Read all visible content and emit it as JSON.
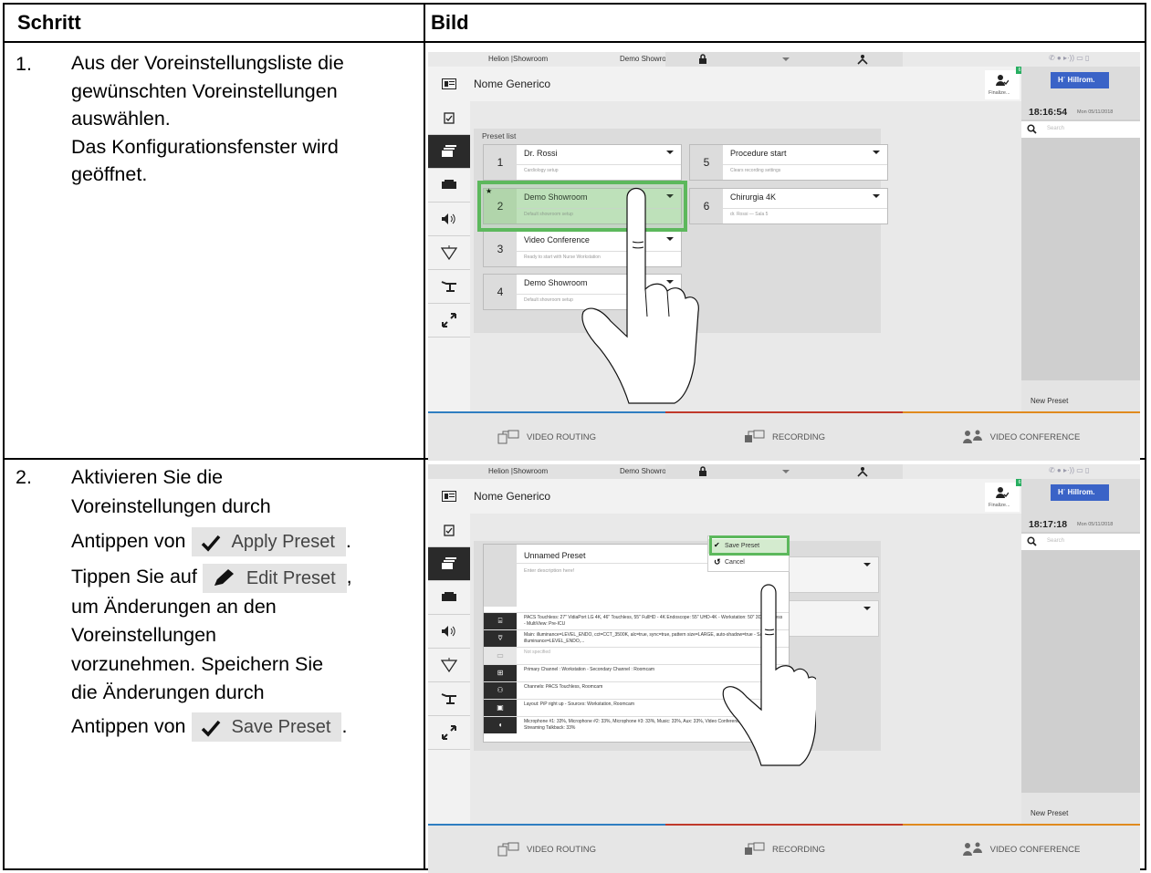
{
  "header": {
    "col_step": "Schritt",
    "col_image": "Bild"
  },
  "rows": [
    {
      "num": "1.",
      "lines": [
        "Aus der Voreinstellungsliste die",
        "gewünschten Voreinstellungen",
        "auswählen.",
        "Das Konfigurationsfenster wird",
        "geöffnet."
      ]
    },
    {
      "num": "2.",
      "line1": "Aktivieren Sie die",
      "line2": "Voreinstellungen durch",
      "line3_pre": "Antippen von",
      "apply_chip": "Apply Preset",
      "line3_post": ".",
      "line4_pre": "Tippen Sie auf",
      "edit_chip": "Edit Preset",
      "line4_post": ",",
      "line5": "um Änderungen an den",
      "line6": "Voreinstellungen",
      "line7": "vorzunehmen. Speichern Sie",
      "line8": "die Änderungen durch",
      "line9_pre": "Antippen von",
      "save_chip": "Save Preset",
      "line9_post": "."
    }
  ],
  "screen1": {
    "topbar": {
      "left": "Helion |Showroom",
      "mid": "Demo Showroom"
    },
    "user": "Nome Generico",
    "finalize": "Finalize...",
    "brand": "Hillrom.",
    "brand_mark": "H",
    "clock": "18:16:54",
    "date": "Mon 05/11/2018",
    "search_placeholder": "Search",
    "new_preset": "New Preset",
    "preset_list_label": "Preset list",
    "presets": [
      {
        "num": "1",
        "name": "Dr. Rossi",
        "desc": "Cardiology setup"
      },
      {
        "num": "2",
        "name": "Demo Showroom",
        "desc": "Default showroom setup",
        "star": "★"
      },
      {
        "num": "3",
        "name": "Video Conference",
        "desc": "Ready to start with Nurse Workstation"
      },
      {
        "num": "4",
        "name": "Demo Showroom",
        "desc": "Default showroom setup"
      },
      {
        "num": "5",
        "name": "Procedure start",
        "desc": "Clears recording settings"
      },
      {
        "num": "6",
        "name": "Chirurgia 4K",
        "desc": "dr. Rossi — Sala 5"
      }
    ],
    "tabs": [
      "VIDEO ROUTING",
      "RECORDING",
      "VIDEO CONFERENCE"
    ],
    "notif_badge": "6"
  },
  "screen2": {
    "topbar": {
      "left": "Helion |Showroom",
      "mid": "Demo Showroom"
    },
    "user": "Nome Generico",
    "finalize": "Finalize...",
    "brand": "Hillrom.",
    "brand_mark": "H",
    "clock": "18:17:18",
    "date": "Mon 05/11/2018",
    "search_placeholder": "Search",
    "new_preset": "New Preset",
    "dialog_title": "Unnamed Preset",
    "dialog_desc": "Enter description here!",
    "save_preset": "Save Preset",
    "cancel": "Cancel",
    "details": [
      "PACS Touchless: 27\" VidiaPort LG 4K, 46\" Touchless, 55\" FullHD - 4K Endoscope: 55\" UHD-4K - Workstation: 50\" 3D Glassless - MultiView: Pre-ICU",
      "Main: illuminance=LEVEL_ENDO, cct=CCT_3500K, alc=true, sync=true, pattern size=LARGE, auto-shadow=true - Satellite: illuminance=LEVEL_ENDO,...",
      "Not specified",
      "Primary Channel : Workstation - Secondary Channel : Roomcam",
      "Channels: PACS Touchless, Roomcam",
      "Layout: PiP right up - Sources: Workstation, Roomcam",
      "Microphone #1: 33%, Microphone #2: 33%, Microphone #3: 33%, Music: 33%, Aux: 33%, Video Conference Talkback: 33%, Streaming Talkback: 33%"
    ],
    "tabs": [
      "VIDEO ROUTING",
      "RECORDING",
      "VIDEO CONFERENCE"
    ],
    "notif_badge": "6"
  },
  "colors": {
    "highlight": "#5cb85c",
    "tab_blue": "#2f7ec1",
    "tab_red": "#c0392b",
    "tab_orange": "#e08a1e",
    "brand_blue": "#3a63c7"
  }
}
